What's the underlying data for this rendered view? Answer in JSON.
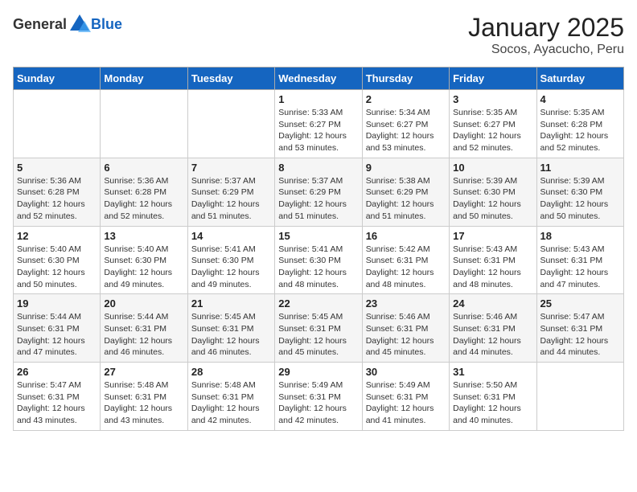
{
  "header": {
    "logo_general": "General",
    "logo_blue": "Blue",
    "month": "January 2025",
    "location": "Socos, Ayacucho, Peru"
  },
  "days_of_week": [
    "Sunday",
    "Monday",
    "Tuesday",
    "Wednesday",
    "Thursday",
    "Friday",
    "Saturday"
  ],
  "weeks": [
    [
      {
        "day": "",
        "info": ""
      },
      {
        "day": "",
        "info": ""
      },
      {
        "day": "",
        "info": ""
      },
      {
        "day": "1",
        "info": "Sunrise: 5:33 AM\nSunset: 6:27 PM\nDaylight: 12 hours\nand 53 minutes."
      },
      {
        "day": "2",
        "info": "Sunrise: 5:34 AM\nSunset: 6:27 PM\nDaylight: 12 hours\nand 53 minutes."
      },
      {
        "day": "3",
        "info": "Sunrise: 5:35 AM\nSunset: 6:27 PM\nDaylight: 12 hours\nand 52 minutes."
      },
      {
        "day": "4",
        "info": "Sunrise: 5:35 AM\nSunset: 6:28 PM\nDaylight: 12 hours\nand 52 minutes."
      }
    ],
    [
      {
        "day": "5",
        "info": "Sunrise: 5:36 AM\nSunset: 6:28 PM\nDaylight: 12 hours\nand 52 minutes."
      },
      {
        "day": "6",
        "info": "Sunrise: 5:36 AM\nSunset: 6:28 PM\nDaylight: 12 hours\nand 52 minutes."
      },
      {
        "day": "7",
        "info": "Sunrise: 5:37 AM\nSunset: 6:29 PM\nDaylight: 12 hours\nand 51 minutes."
      },
      {
        "day": "8",
        "info": "Sunrise: 5:37 AM\nSunset: 6:29 PM\nDaylight: 12 hours\nand 51 minutes."
      },
      {
        "day": "9",
        "info": "Sunrise: 5:38 AM\nSunset: 6:29 PM\nDaylight: 12 hours\nand 51 minutes."
      },
      {
        "day": "10",
        "info": "Sunrise: 5:39 AM\nSunset: 6:30 PM\nDaylight: 12 hours\nand 50 minutes."
      },
      {
        "day": "11",
        "info": "Sunrise: 5:39 AM\nSunset: 6:30 PM\nDaylight: 12 hours\nand 50 minutes."
      }
    ],
    [
      {
        "day": "12",
        "info": "Sunrise: 5:40 AM\nSunset: 6:30 PM\nDaylight: 12 hours\nand 50 minutes."
      },
      {
        "day": "13",
        "info": "Sunrise: 5:40 AM\nSunset: 6:30 PM\nDaylight: 12 hours\nand 49 minutes."
      },
      {
        "day": "14",
        "info": "Sunrise: 5:41 AM\nSunset: 6:30 PM\nDaylight: 12 hours\nand 49 minutes."
      },
      {
        "day": "15",
        "info": "Sunrise: 5:41 AM\nSunset: 6:30 PM\nDaylight: 12 hours\nand 48 minutes."
      },
      {
        "day": "16",
        "info": "Sunrise: 5:42 AM\nSunset: 6:31 PM\nDaylight: 12 hours\nand 48 minutes."
      },
      {
        "day": "17",
        "info": "Sunrise: 5:43 AM\nSunset: 6:31 PM\nDaylight: 12 hours\nand 48 minutes."
      },
      {
        "day": "18",
        "info": "Sunrise: 5:43 AM\nSunset: 6:31 PM\nDaylight: 12 hours\nand 47 minutes."
      }
    ],
    [
      {
        "day": "19",
        "info": "Sunrise: 5:44 AM\nSunset: 6:31 PM\nDaylight: 12 hours\nand 47 minutes."
      },
      {
        "day": "20",
        "info": "Sunrise: 5:44 AM\nSunset: 6:31 PM\nDaylight: 12 hours\nand 46 minutes."
      },
      {
        "day": "21",
        "info": "Sunrise: 5:45 AM\nSunset: 6:31 PM\nDaylight: 12 hours\nand 46 minutes."
      },
      {
        "day": "22",
        "info": "Sunrise: 5:45 AM\nSunset: 6:31 PM\nDaylight: 12 hours\nand 45 minutes."
      },
      {
        "day": "23",
        "info": "Sunrise: 5:46 AM\nSunset: 6:31 PM\nDaylight: 12 hours\nand 45 minutes."
      },
      {
        "day": "24",
        "info": "Sunrise: 5:46 AM\nSunset: 6:31 PM\nDaylight: 12 hours\nand 44 minutes."
      },
      {
        "day": "25",
        "info": "Sunrise: 5:47 AM\nSunset: 6:31 PM\nDaylight: 12 hours\nand 44 minutes."
      }
    ],
    [
      {
        "day": "26",
        "info": "Sunrise: 5:47 AM\nSunset: 6:31 PM\nDaylight: 12 hours\nand 43 minutes."
      },
      {
        "day": "27",
        "info": "Sunrise: 5:48 AM\nSunset: 6:31 PM\nDaylight: 12 hours\nand 43 minutes."
      },
      {
        "day": "28",
        "info": "Sunrise: 5:48 AM\nSunset: 6:31 PM\nDaylight: 12 hours\nand 42 minutes."
      },
      {
        "day": "29",
        "info": "Sunrise: 5:49 AM\nSunset: 6:31 PM\nDaylight: 12 hours\nand 42 minutes."
      },
      {
        "day": "30",
        "info": "Sunrise: 5:49 AM\nSunset: 6:31 PM\nDaylight: 12 hours\nand 41 minutes."
      },
      {
        "day": "31",
        "info": "Sunrise: 5:50 AM\nSunset: 6:31 PM\nDaylight: 12 hours\nand 40 minutes."
      },
      {
        "day": "",
        "info": ""
      }
    ]
  ]
}
